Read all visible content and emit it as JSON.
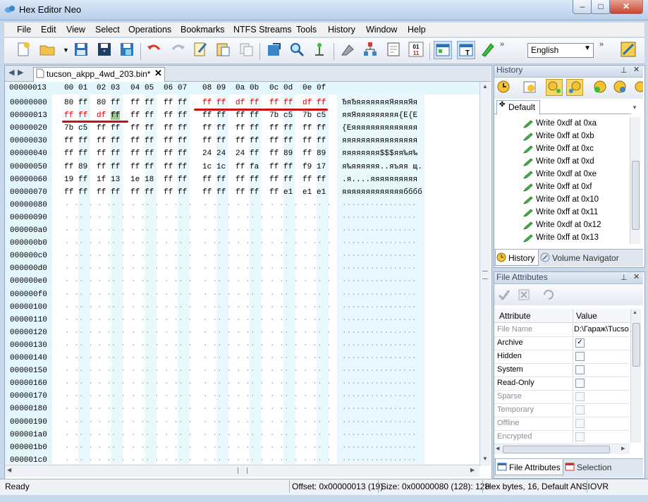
{
  "window": {
    "title": "Hex Editor Neo",
    "min": "–",
    "max": "□",
    "close": "✕"
  },
  "menu": [
    "File",
    "Edit",
    "View",
    "Select",
    "Operations",
    "Bookmarks",
    "NTFS Streams",
    "Tools",
    "History",
    "Window",
    "Help"
  ],
  "toolbar": {
    "language": "English"
  },
  "tab": {
    "label": "tucson_akpp_4wd_203.bin*",
    "close": "✕"
  },
  "editor": {
    "current_offset": "00000013",
    "column_headers": [
      "00",
      "01",
      "02",
      "03",
      "04",
      "05",
      "06",
      "07",
      "08",
      "09",
      "0a",
      "0b",
      "0c",
      "0d",
      "0e",
      "0f"
    ],
    "offsets": [
      "00000000",
      "00000013",
      "00000020",
      "00000030",
      "00000040",
      "00000050",
      "00000060",
      "00000070",
      "00000080",
      "00000090",
      "000000a0",
      "000000b0",
      "000000c0",
      "000000d0",
      "000000e0",
      "000000f0",
      "00000100",
      "00000110",
      "00000120",
      "00000130",
      "00000140",
      "00000150",
      "00000160",
      "00000170",
      "00000180",
      "00000190",
      "000001a0",
      "000001b0",
      "000001c0"
    ],
    "hex_rows": [
      [
        "80",
        "ff",
        "80",
        "ff",
        "ff",
        "ff",
        "ff",
        "ff",
        "ff",
        "ff",
        "df",
        "ff",
        "ff",
        "ff",
        "df",
        "ff"
      ],
      [
        "ff",
        "ff",
        "df",
        "ff",
        "ff",
        "ff",
        "ff",
        "ff",
        "ff",
        "ff",
        "ff",
        "ff",
        "7b",
        "c5",
        "7b",
        "c5"
      ],
      [
        "7b",
        "c5",
        "ff",
        "ff",
        "ff",
        "ff",
        "ff",
        "ff",
        "ff",
        "ff",
        "ff",
        "ff",
        "ff",
        "ff",
        "ff",
        "ff"
      ],
      [
        "ff",
        "ff",
        "ff",
        "ff",
        "ff",
        "ff",
        "ff",
        "ff",
        "ff",
        "ff",
        "ff",
        "ff",
        "ff",
        "ff",
        "ff",
        "ff"
      ],
      [
        "ff",
        "ff",
        "ff",
        "ff",
        "ff",
        "ff",
        "ff",
        "ff",
        "24",
        "24",
        "24",
        "ff",
        "ff",
        "89",
        "ff",
        "89"
      ],
      [
        "ff",
        "89",
        "ff",
        "ff",
        "ff",
        "ff",
        "ff",
        "ff",
        "1c",
        "1c",
        "ff",
        "fa",
        "ff",
        "ff",
        "f9",
        "17"
      ],
      [
        "19",
        "ff",
        "1f",
        "13",
        "1e",
        "18",
        "ff",
        "ff",
        "ff",
        "ff",
        "ff",
        "ff",
        "ff",
        "ff",
        "ff",
        "ff"
      ],
      [
        "ff",
        "ff",
        "ff",
        "ff",
        "ff",
        "ff",
        "ff",
        "ff",
        "ff",
        "ff",
        "ff",
        "ff",
        "ff",
        "e1",
        "e1",
        "e1"
      ]
    ],
    "text_rows": [
      "ЂяЂяяяяяяяЯяяяЯя",
      "яяЯяяяяяяяяя{Е{Е",
      "{Еяяяяяяяяяяяяяя",
      "яяяяяяяяяяяяяяяя",
      "яяяяяяяя$$$яя‰я‰",
      "я‰яяяяяя..яъяя щ.",
      ".я....яяяяяяяяяя",
      "яяяяяяяяяяяяябббб"
    ],
    "empty_hex": ". .",
    "empty_text": "................"
  },
  "history": {
    "title": "History",
    "default_tab": "Default",
    "items": [
      "Write 0xdf at 0xa",
      "Write 0xff at 0xb",
      "Write 0xff at 0xc",
      "Write 0xff at 0xd",
      "Write 0xdf at 0xe",
      "Write 0xff at 0xf",
      "Write 0xff at 0x10",
      "Write 0xff at 0x11",
      "Write 0xdf at 0x12",
      "Write 0xff at 0x13"
    ],
    "bottom_tabs": [
      "History",
      "Volume Navigator"
    ]
  },
  "attributes": {
    "title": "File Attributes",
    "headers": [
      "Attribute",
      "Value"
    ],
    "file_name_label": "File Name",
    "file_name_value": "D:\\Гараж\\Tucso",
    "rows": [
      {
        "name": "Archive",
        "checked": true,
        "enabled": true
      },
      {
        "name": "Hidden",
        "checked": false,
        "enabled": true
      },
      {
        "name": "System",
        "checked": false,
        "enabled": true
      },
      {
        "name": "Read-Only",
        "checked": false,
        "enabled": true
      },
      {
        "name": "Sparse",
        "checked": false,
        "enabled": false
      },
      {
        "name": "Temporary",
        "checked": false,
        "enabled": false
      },
      {
        "name": "Offline",
        "checked": false,
        "enabled": false
      },
      {
        "name": "Encrypted",
        "checked": false,
        "enabled": false
      }
    ],
    "bottom_tabs": [
      "File Attributes",
      "Selection"
    ]
  },
  "status": {
    "ready": "Ready",
    "offset": "Offset: 0x00000013 (19)",
    "size": "Size: 0x00000080 (128): 128",
    "mode": "Hex bytes, 16, Default ANSI",
    "ovr": "OVR"
  }
}
